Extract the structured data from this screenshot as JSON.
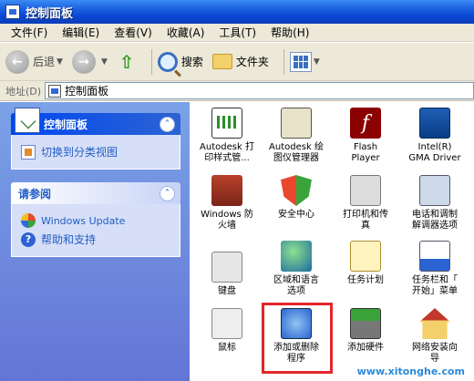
{
  "window": {
    "title": "控制面板"
  },
  "menu": [
    "文件(F)",
    "编辑(E)",
    "查看(V)",
    "收藏(A)",
    "工具(T)",
    "帮助(H)"
  ],
  "toolbar": {
    "back": "后退",
    "search": "搜索",
    "folders": "文件夹"
  },
  "address": {
    "label": "地址(D)",
    "value": "控制面板"
  },
  "left_panels": {
    "control_panel": {
      "title": "控制面板",
      "link": "切换到分类视图"
    },
    "see_also": {
      "title": "请参阅",
      "links": [
        "Windows Update",
        "帮助和支持"
      ]
    }
  },
  "items": [
    {
      "label": "Autodesk 打\n印样式管...",
      "icon": "autodesk-plot-style-icon"
    },
    {
      "label": "Autodesk 绘\n图仪管理器",
      "icon": "autodesk-plotter-icon"
    },
    {
      "label": "Flash\nPlayer",
      "icon": "flash-player-icon"
    },
    {
      "label": "Intel(R)\nGMA Driver",
      "icon": "intel-gma-icon"
    },
    {
      "label": "Windows 防\n火墙",
      "icon": "firewall-icon"
    },
    {
      "label": "安全中心",
      "icon": "security-center-icon"
    },
    {
      "label": "打印机和传\n真",
      "icon": "printer-icon"
    },
    {
      "label": "电话和调制\n解调器选项",
      "icon": "phone-modem-icon"
    },
    {
      "label": "键盘",
      "icon": "keyboard-icon"
    },
    {
      "label": "区域和语言\n选项",
      "icon": "globe-icon"
    },
    {
      "label": "任务计划",
      "icon": "scheduled-tasks-icon"
    },
    {
      "label": "任务栏和「\n开始」菜单",
      "icon": "taskbar-icon"
    },
    {
      "label": "鼠标",
      "icon": "mouse-icon"
    },
    {
      "label": "添加或删除\n程序",
      "icon": "add-remove-programs-icon"
    },
    {
      "label": "添加硬件",
      "icon": "add-hardware-icon"
    },
    {
      "label": "网络安装向\n导",
      "icon": "network-setup-icon"
    }
  ],
  "watermark": "www.xitonghe.com",
  "colors": {
    "highlight": "#e3262a",
    "titlebar": "#0a48d6",
    "left_pane": "#6f8fe0"
  }
}
